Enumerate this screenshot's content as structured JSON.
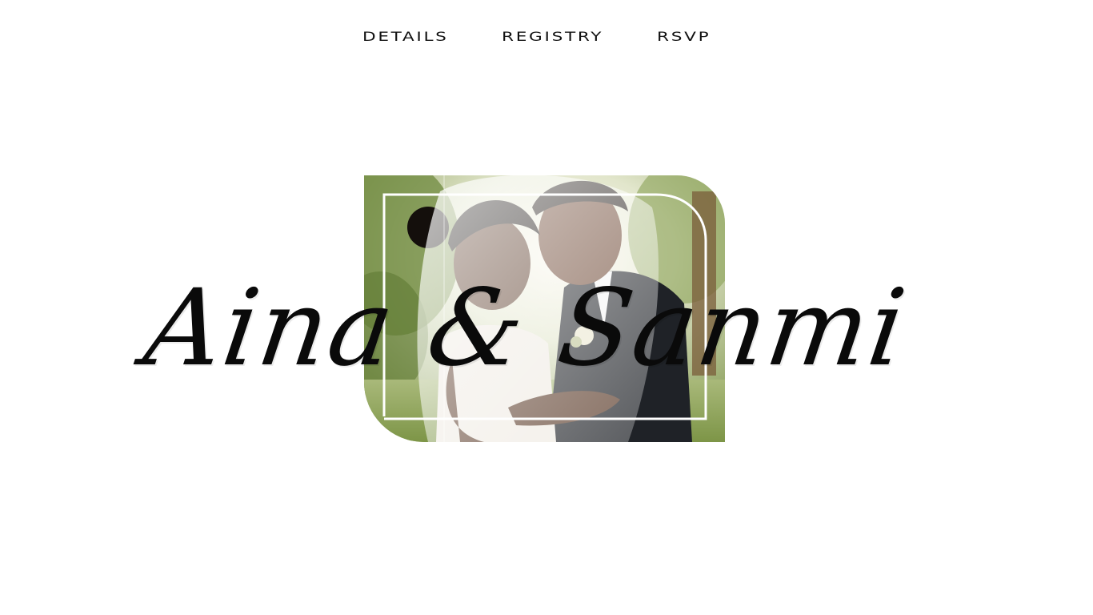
{
  "nav": {
    "items": [
      {
        "label": "DETAILS"
      },
      {
        "label": "REGISTRY"
      },
      {
        "label": "RSVP"
      }
    ]
  },
  "hero": {
    "names": "Aina & Sanmi",
    "photo_icon": "couple-photo"
  },
  "colors": {
    "text": "#111111",
    "background": "#ffffff",
    "foliage": "#7f9a52",
    "suit": "#1f2227",
    "dress": "#efeae2"
  }
}
